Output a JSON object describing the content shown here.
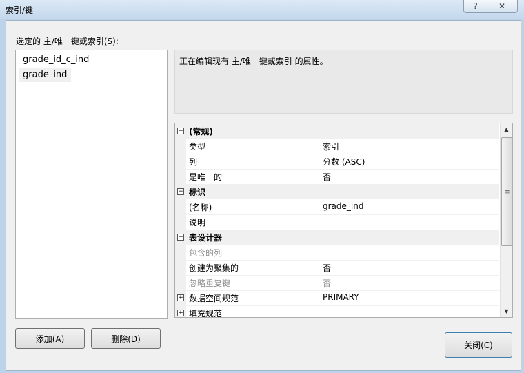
{
  "window": {
    "title": "索引/键",
    "help_label": "?",
    "close_label": "✕"
  },
  "selected_label": "选定的 主/唯一键或索引(S):",
  "index_list": [
    "grade_id_c_ind",
    "grade_ind"
  ],
  "description": "正在编辑现有 主/唯一键或索引 的属性。",
  "properties": {
    "general": {
      "title": "(常规)",
      "type_label": "类型",
      "type_value": "索引",
      "columns_label": "列",
      "columns_value": "分数 (ASC)",
      "unique_label": "是唯一的",
      "unique_value": "否"
    },
    "identity": {
      "title": "标识",
      "name_label": "(名称)",
      "name_value": "grade_ind",
      "desc_label": "说明",
      "desc_value": ""
    },
    "designer": {
      "title": "表设计器",
      "included_label": "包含的列",
      "included_value": "",
      "clustered_label": "创建为聚集的",
      "clustered_value": "否",
      "ignore_dup_label": "忽略重复键",
      "ignore_dup_value": "否",
      "dataspace_label": "数据空间规范",
      "dataspace_value": "PRIMARY",
      "fill_label": "填充规范"
    }
  },
  "buttons": {
    "add": "添加(A)",
    "delete": "删除(D)",
    "close": "关闭(C)"
  },
  "colors": {
    "frame": "#bcd3ea",
    "dialog_bg": "#f0f0f0",
    "disabled_text": "#8d8d8d"
  },
  "icons": {
    "collapse": "minus-box-icon",
    "expand": "plus-box-icon",
    "scroll_up": "arrow-up-icon",
    "scroll_down": "arrow-down-icon"
  }
}
